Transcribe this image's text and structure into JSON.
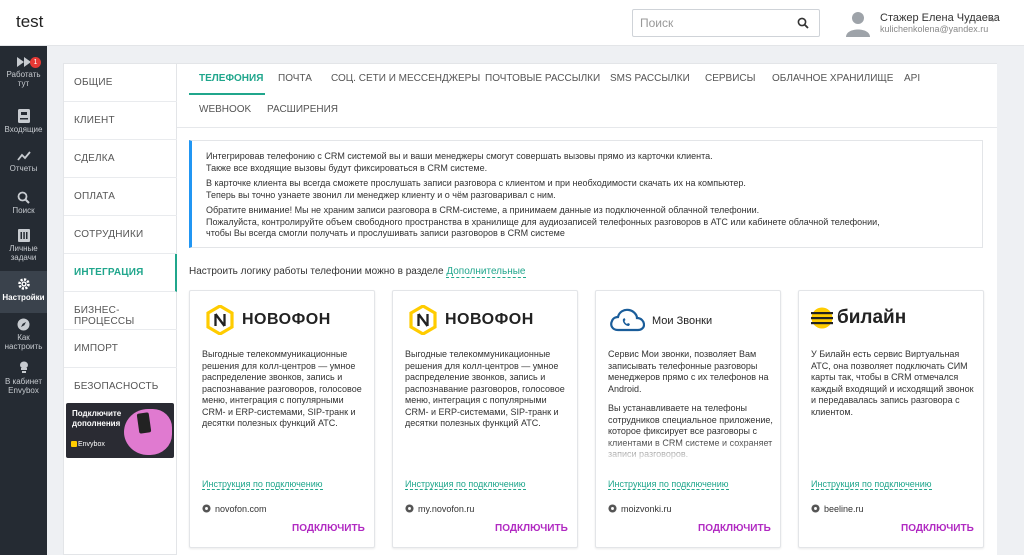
{
  "header": {
    "title": "test",
    "search_placeholder": "Поиск",
    "user_name": "Стажер Елена Чудаева",
    "user_email": "kulichenkolena@yandex.ru"
  },
  "leftnav": {
    "items": [
      {
        "label": "Работать тут",
        "icon": "fast-forward-icon",
        "badge": "1"
      },
      {
        "label": "Входящие",
        "icon": "inbox-icon"
      },
      {
        "label": "Отчеты",
        "icon": "chart-line-icon"
      },
      {
        "label": "Поиск",
        "icon": "search-icon"
      },
      {
        "label": "Личные задачи",
        "icon": "tasks-icon"
      },
      {
        "label": "Настройки",
        "icon": "gear-icon"
      },
      {
        "label": "Как настроить",
        "icon": "compass-icon"
      },
      {
        "label": "В кабинет Envybox",
        "icon": "envybox-icon"
      }
    ]
  },
  "submenu": {
    "items": [
      "Общие",
      "Клиент",
      "Сделка",
      "Оплата",
      "Сотрудники",
      "Интеграция",
      "Бизнес-процессы",
      "Импорт",
      "Безопасность"
    ],
    "active": "Интеграция",
    "promo_text": "Подключите дополнения",
    "promo_brand": "Envybox"
  },
  "tabs": [
    "Телефония",
    "Почта",
    "Соц. сети и мессенджеры",
    "Почтовые рассылки",
    "SMS рассылки",
    "Сервисы",
    "Облачное хранилище",
    "API",
    "Webhook",
    "Расширения"
  ],
  "info": {
    "p1a": "Интегрировав телефонию с CRM системой вы и ваши менеджеры смогут совершать вызовы прямо из карточки клиента.",
    "p1b": "Также все входящие вызовы будут фиксироваться в CRM системе.",
    "p2a": "В карточке клиента вы всегда сможете прослушать записи разговора с клиентом и при необходимости скачать их на компьютер.",
    "p2b": "Теперь вы точно узнаете звонил ли менеджер клиенту и о чём разговаривал с ним.",
    "p3a": "Обратите внимание! Мы не храним записи разговора в CRM-системе, а принимаем данные из подключенной облачной телефонии.",
    "p3b": "Пожалуйста, контролируйте объем свободного пространства в хранилище для аудиозаписей телефонных разговоров в АТС или кабинете облачной телефонии,",
    "p3c": "чтобы Вы всегда смогли получать и прослушивать записи разговоров в CRM системе"
  },
  "config": {
    "text": "Настроить логику работы телефонии можно в разделе ",
    "link": "Дополнительные"
  },
  "cards": [
    {
      "brand": "НОВОФОН",
      "desc": "Выгодные телекоммуникационные решения для колл-центров — умное распределение звонков, запись и распознавание разговоров, голосовое меню, интеграция с популярными CRM- и ERP-системами, SIP-транк и десятки полезных функций АТС.",
      "desc2": "",
      "link": "Инструкция по подключению",
      "site": "novofon.com",
      "action": "Подключить"
    },
    {
      "brand": "НОВОФОН",
      "desc": "Выгодные телекоммуникационные решения для колл-центров — умное распределение звонков, запись и распознавание разговоров, голосовое меню, интеграция с популярными CRM- и ERP-системами, SIP-транк и десятки полезных функций АТС.",
      "desc2": "",
      "link": "Инструкция по подключению",
      "site": "my.novofon.ru",
      "action": "Подключить"
    },
    {
      "brand": "Мои Звонки",
      "desc": "Сервис Мои звонки, позволяет Вам записывать телефонные разговоры менеджеров прямо с их телефонов на Android.",
      "desc2": "Вы устанавливаете на телефоны сотрудников специальное приложение, которое фиксирует все разговоры с клиентами в CRM системе и сохраняет записи разговоров.",
      "link": "Инструкция по подключению",
      "site": "moizvonki.ru",
      "action": "Подключить"
    },
    {
      "brand": "билайн",
      "desc": "У Билайн есть сервис Виртуальная АТС, она позволяет подключать СИМ карты так, чтобы в CRM отмечался каждый входящий и исходящий звонок и передавалась запись разговора с клиентом.",
      "desc2": "",
      "link": "Инструкция по подключению",
      "site": "beeline.ru",
      "action": "Подключить"
    }
  ],
  "colors": {
    "accent": "#20a68c",
    "connect": "#b12ac2",
    "info_border": "#2196f3",
    "nav_bg": "#252b33",
    "novofon_yellow": "#ffcc00"
  }
}
